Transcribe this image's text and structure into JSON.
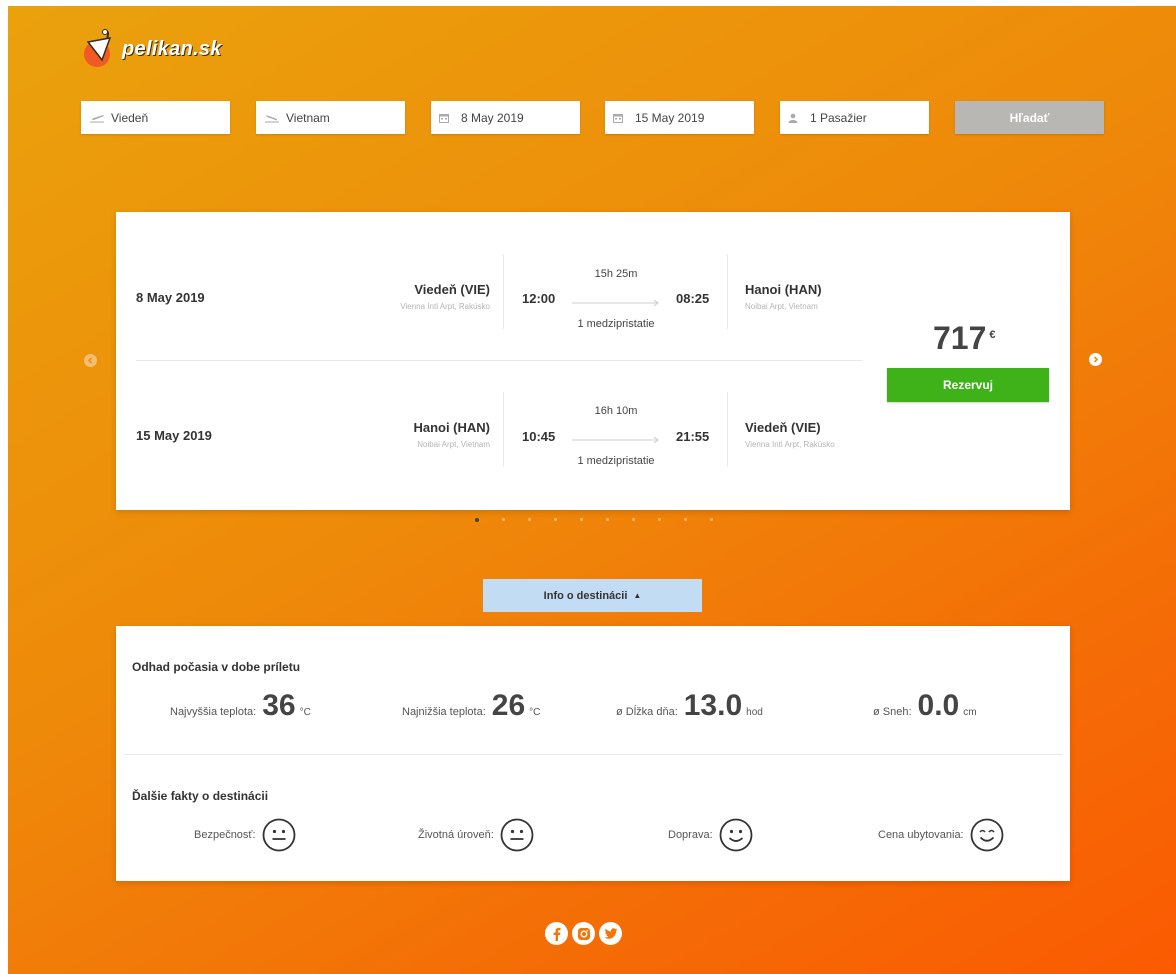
{
  "brand": {
    "name": "pelikan.sk"
  },
  "search": {
    "from": "Viedeň",
    "to": "Vietnam",
    "depart_date": "8 May 2019",
    "return_date": "15 May 2019",
    "passengers": "1 Pasažier",
    "button_label": "Hľadať"
  },
  "flight": {
    "outbound": {
      "date": "8 May 2019",
      "from_city": "Viedeň (VIE)",
      "from_airport": "Vienna Intl Arpt, Rakúsko",
      "depart_time": "12:00",
      "duration": "15h 25m",
      "stops": "1 medzipristatie",
      "arrive_time": "08:25",
      "to_city": "Hanoi (HAN)",
      "to_airport": "Noibai Arpt, Vietnam"
    },
    "inbound": {
      "date": "15 May 2019",
      "from_city": "Hanoi (HAN)",
      "from_airport": "Noibai Arpt, Vietnam",
      "depart_time": "10:45",
      "duration": "16h 10m",
      "stops": "1 medzipristatie",
      "arrive_time": "21:55",
      "to_city": "Viedeň (VIE)",
      "to_airport": "Vienna Intl Arpt, Rakúsko"
    },
    "price": "717",
    "currency": "€",
    "book_label": "Rezervuj"
  },
  "carousel": {
    "page_count": 10,
    "active_index": 0
  },
  "info_toggle_label": "Info o destinácii",
  "weather": {
    "title": "Odhad počasia v dobe príletu",
    "max_temp": {
      "label": "Najvyššia teplota:",
      "value": "36",
      "unit": "°C"
    },
    "min_temp": {
      "label": "Najnižšia teplota:",
      "value": "26",
      "unit": "°C"
    },
    "day_length": {
      "label": "ø Dĺžka dňa:",
      "value": "13.0",
      "unit": "hod"
    },
    "snow": {
      "label": "ø Sneh:",
      "value": "0.0",
      "unit": "cm"
    }
  },
  "facts": {
    "title": "Ďalšie fakty o destinácii",
    "items": [
      {
        "label": "Bezpečnosť:",
        "rating_icon": "neutral-face-icon"
      },
      {
        "label": "Životná úroveň:",
        "rating_icon": "neutral-face-icon"
      },
      {
        "label": "Doprava:",
        "rating_icon": "smile-face-icon"
      },
      {
        "label": "Cena ubytovania:",
        "rating_icon": "happy-face-icon"
      }
    ]
  },
  "social": [
    "facebook-icon",
    "instagram-icon",
    "twitter-icon"
  ],
  "colors": {
    "background_start": "#eaa20c",
    "background_end": "#fb5a02",
    "book_button": "#3eb218",
    "search_button": "#b9b7b4",
    "info_toggle": "#c2dcf4"
  }
}
